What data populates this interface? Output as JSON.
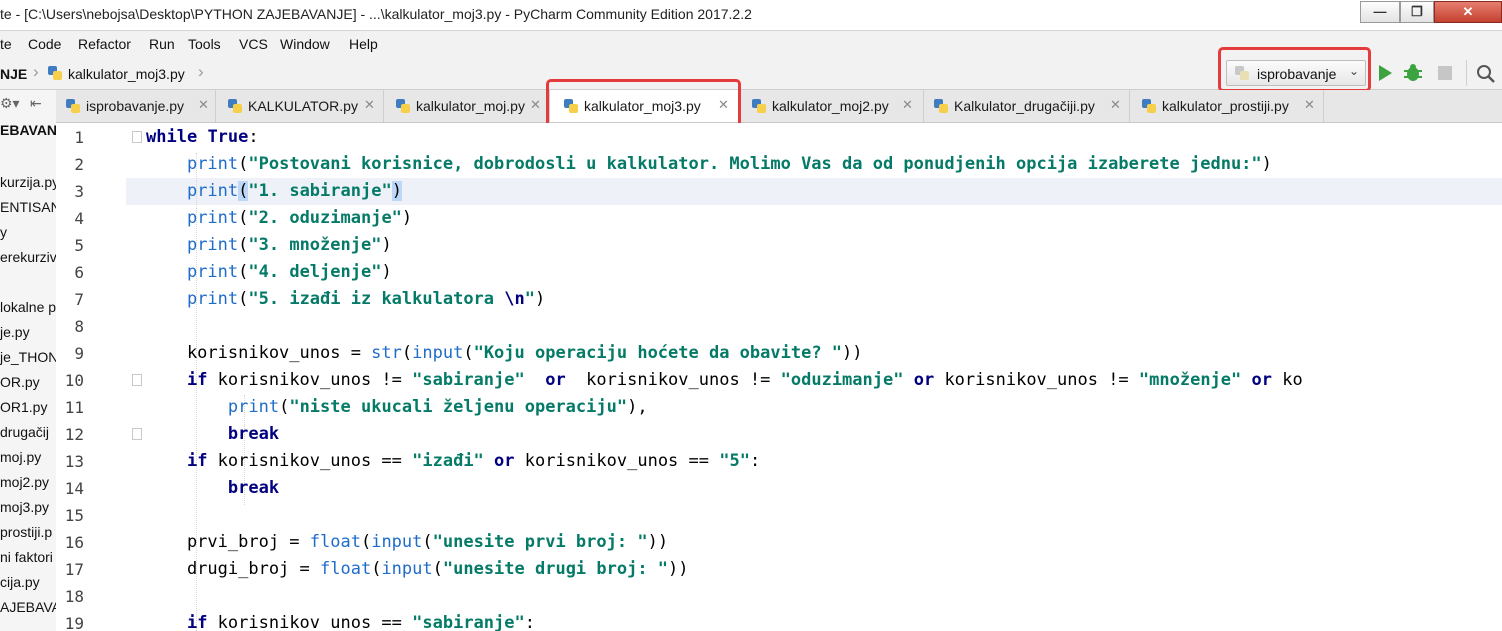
{
  "window": {
    "title": "te - [C:\\Users\\nebojsa\\Desktop\\PYTHON ZAJEBAVANJE] - ...\\kalkulator_moj3.py - PyCharm Community Edition 2017.2.2"
  },
  "menu": [
    "te",
    "Code",
    "Refactor",
    "Run",
    "Tools",
    "VCS",
    "Window",
    "Help"
  ],
  "breadcrumb": {
    "project": "NJE",
    "file": "kalkulator_moj3.py"
  },
  "run_config": "isprobavanje",
  "tabs": [
    {
      "label": "isprobavanje.py"
    },
    {
      "label": "KALKULATOR.py"
    },
    {
      "label": "kalkulator_moj.py"
    },
    {
      "label": "kalkulator_moj3.py",
      "active": true
    },
    {
      "label": "kalkulator_moj2.py"
    },
    {
      "label": "Kalkulator_drugačiji.py"
    },
    {
      "label": "kalkulator_prostiji.py"
    }
  ],
  "project_panel": {
    "header": "EBAVAN",
    "items": [
      "kurzija.py",
      "ENTISAN",
      "y",
      "erekurzivi",
      "",
      "lokalne p",
      "je.py",
      "je_THON",
      "OR.py",
      "OR1.py",
      "drugačij",
      "moj.py",
      "moj2.py",
      "moj3.py",
      "prostiji.p",
      "ni faktori",
      "cija.py",
      "AJEBAVA"
    ]
  },
  "editor": {
    "line_numbers": [
      "1",
      "2",
      "3",
      "4",
      "5",
      "6",
      "7",
      "8",
      "9",
      "10",
      "11",
      "12",
      "13",
      "14",
      "15",
      "16",
      "17",
      "18",
      "19"
    ],
    "lines": [
      "while True:",
      "    print(\"Postovani korisnice, dobrodosli u kalkulator. Molimo Vas da od ponudjenih opcija izaberete jednu:\")",
      "    print(\"1. sabiranje\")",
      "    print(\"2. oduzimanje\")",
      "    print(\"3. množenje\")",
      "    print(\"4. deljenje\")",
      "    print(\"5. izađi iz kalkulatora \\n\")",
      "",
      "    korisnikov_unos = str(input(\"Koju operaciju hoćete da obavite? \"))",
      "    if korisnikov_unos != \"sabiranje\"  or  korisnikov_unos != \"oduzimanje\" or korisnikov_unos != \"množenje\" or ko",
      "        print(\"niste ukucali željenu operaciju\"),",
      "        break",
      "    if korisnikov_unos == \"izađi\" or korisnikov_unos == \"5\":",
      "        break",
      "",
      "    prvi_broj = float(input(\"unesite prvi broj: \"))",
      "    drugi_broj = float(input(\"unesite drugi broj: \"))",
      "",
      "    if korisnikov_unos == \"sabiranje\":"
    ]
  },
  "colors": {
    "highlight_frame": "#e43c3c",
    "keyword": "#000080",
    "string": "#047a67",
    "builtin": "#1f6cc9",
    "current_line": "#eef2f8"
  },
  "icons": {
    "run": "play-triangle",
    "debug": "bug",
    "stop": "square",
    "search": "magnifier",
    "settings": "gear",
    "python_file": "python-logo"
  }
}
